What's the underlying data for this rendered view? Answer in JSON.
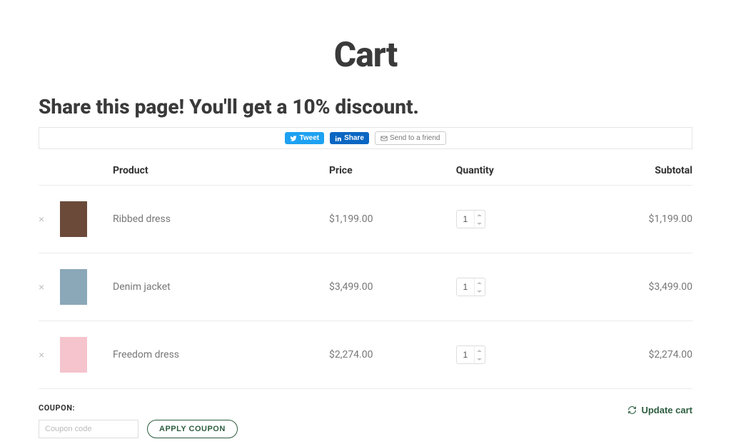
{
  "page": {
    "title": "Cart"
  },
  "share": {
    "heading": "Share this page! You'll get a 10% discount.",
    "tweet_label": "Tweet",
    "linkedin_label": "Share",
    "friend_label": "Send to a friend"
  },
  "table": {
    "headers": {
      "product": "Product",
      "price": "Price",
      "quantity": "Quantity",
      "subtotal": "Subtotal"
    },
    "rows": [
      {
        "name": "Ribbed dress",
        "price": "$1,199.00",
        "qty": "1",
        "subtotal": "$1,199.00",
        "thumb_bg": "#6b4a3a"
      },
      {
        "name": "Denim jacket",
        "price": "$3,499.00",
        "qty": "1",
        "subtotal": "$3,499.00",
        "thumb_bg": "#8aa8b8"
      },
      {
        "name": "Freedom dress",
        "price": "$2,274.00",
        "qty": "1",
        "subtotal": "$2,274.00",
        "thumb_bg": "#f5c4cd"
      }
    ]
  },
  "coupon": {
    "label": "COUPON:",
    "placeholder": "Coupon code",
    "apply_label": "APPLY COUPON"
  },
  "update_label": "Update cart"
}
